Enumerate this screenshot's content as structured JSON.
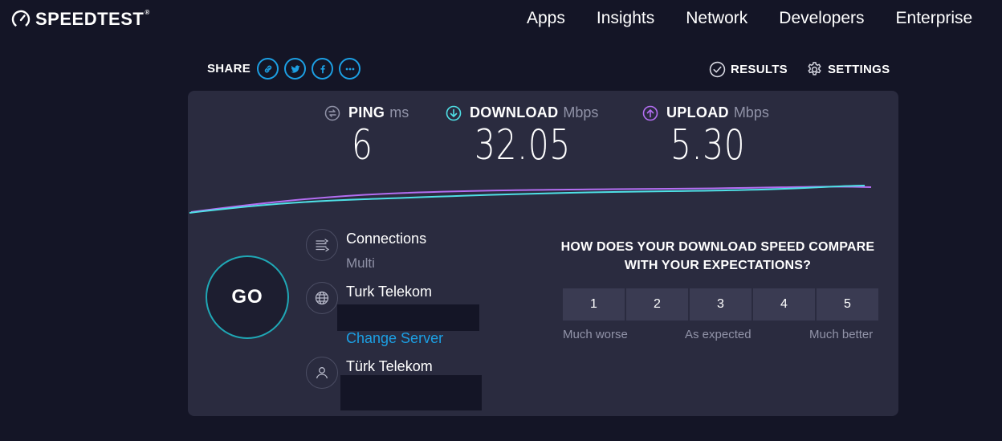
{
  "header": {
    "logo_text": "SPEEDTEST",
    "logo_mark": "®",
    "nav": [
      "Apps",
      "Insights",
      "Network",
      "Developers",
      "Enterprise"
    ]
  },
  "share": {
    "label": "SHARE",
    "buttons": [
      "link-icon",
      "twitter-icon",
      "facebook-icon",
      "more-icon"
    ]
  },
  "actions": {
    "results_label": "RESULTS",
    "settings_label": "SETTINGS"
  },
  "metrics": {
    "ping": {
      "label": "PING",
      "unit": "ms",
      "value": "6"
    },
    "download": {
      "label": "DOWNLOAD",
      "unit": "Mbps",
      "value": "32.05"
    },
    "upload": {
      "label": "UPLOAD",
      "unit": "Mbps",
      "value": "5.30"
    }
  },
  "go_label": "GO",
  "connections": {
    "title": "Connections",
    "value": "Multi"
  },
  "server": {
    "name": "Turk Telekom",
    "change_label": "Change Server"
  },
  "provider": {
    "name": "Türk Telekom"
  },
  "survey": {
    "question": "HOW DOES YOUR DOWNLOAD SPEED COMPARE WITH YOUR EXPECTATIONS?",
    "options": [
      "1",
      "2",
      "3",
      "4",
      "5"
    ],
    "low_label": "Much worse",
    "mid_label": "As expected",
    "high_label": "Much better"
  },
  "colors": {
    "background": "#141526",
    "panel": "#2a2b3f",
    "accent_blue": "#1c9fe3",
    "download_cyan": "#4fe0e6",
    "upload_purple": "#b36ef2",
    "go_ring": "#1fa8b6"
  }
}
